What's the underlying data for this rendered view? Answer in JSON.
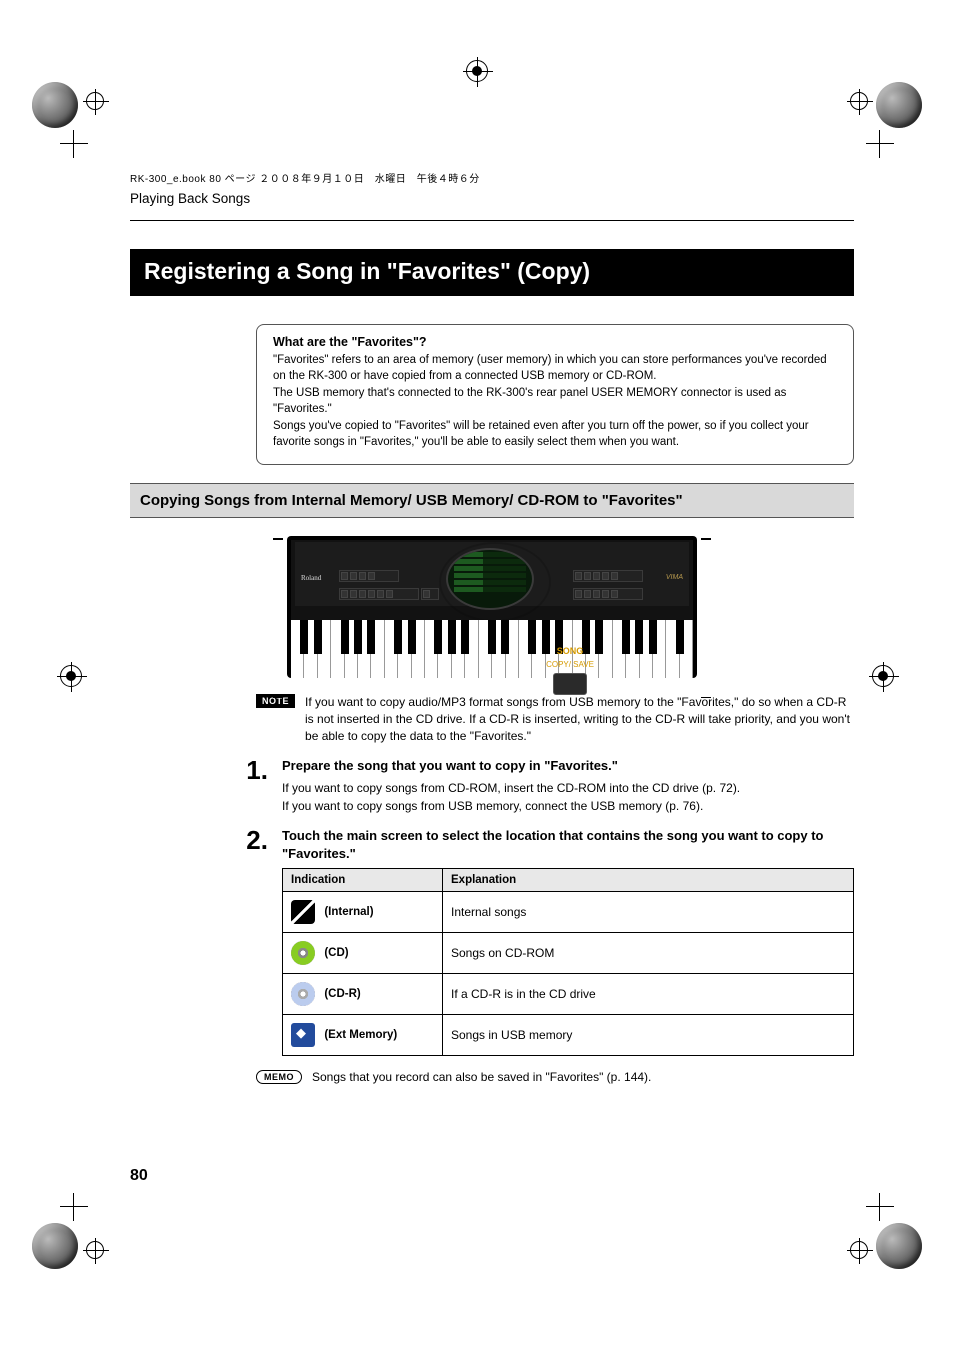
{
  "header": {
    "book_line": "RK-300_e.book  80 ページ  ２００８年９月１０日　水曜日　午後４時６分",
    "section_title": "Playing Back Songs"
  },
  "title_band": "Registering a Song in \"Favorites\" (Copy)",
  "info_box": {
    "title": "What are the \"Favorites\"?",
    "p1": "\"Favorites\" refers to an area of memory (user memory) in which you can store performances you've recorded on the RK-300 or have copied from a connected USB memory or CD-ROM.",
    "p2": "The USB memory that's connected to the RK-300's rear panel USER MEMORY connector is used as \"Favorites.\"",
    "p3": "Songs you've copied to \"Favorites\" will be retained even after you turn off the power, so if you collect your favorite songs in \"Favorites,\" you'll be able to easily select them when you want."
  },
  "gray_band": "Copying Songs from Internal Memory/ USB Memory/ CD-ROM to \"Favorites\"",
  "figure": {
    "brand": "Roland",
    "subbrand": "",
    "right_logo": "VIMA",
    "callout_song": "SONG",
    "callout_copy": "COPY/\nSAVE"
  },
  "note_badge": "NOTE",
  "note_text": "If you want to copy audio/MP3 format songs from USB memory to the \"Favorites,\" do so when a CD-R is not inserted in the CD drive. If a CD-R is inserted, writing to the CD-R will take priority, and you won't be able to copy the data to the \"Favorites.\"",
  "step1": {
    "num": "1",
    "lead": "Prepare the song that you want to copy in \"Favorites.\"",
    "p1": "If you want to copy songs from CD-ROM, insert the CD-ROM into the CD drive (p. 72).",
    "p2": "If you want to copy songs from USB memory, connect the USB memory (p. 76)."
  },
  "step2": {
    "num": "2",
    "lead": "Touch the main screen to select the location that contains the song you want to copy to \"Favorites.\""
  },
  "table": {
    "head_indication": "Indication",
    "head_explanation": "Explanation",
    "rows": [
      {
        "icon": "internal",
        "label": "(Internal)",
        "explanation": "Internal songs"
      },
      {
        "icon": "cd",
        "label": "(CD)",
        "explanation": "Songs on CD-ROM"
      },
      {
        "icon": "cdr",
        "label": "(CD-R)",
        "explanation": "If a CD-R is in the CD drive"
      },
      {
        "icon": "usb",
        "label": "(Ext Memory)",
        "explanation": "Songs in USB memory"
      }
    ]
  },
  "memo_badge": "MEMO",
  "memo_text": "Songs that you record can also be saved in \"Favorites\" (p. 144).",
  "page_number": "80"
}
